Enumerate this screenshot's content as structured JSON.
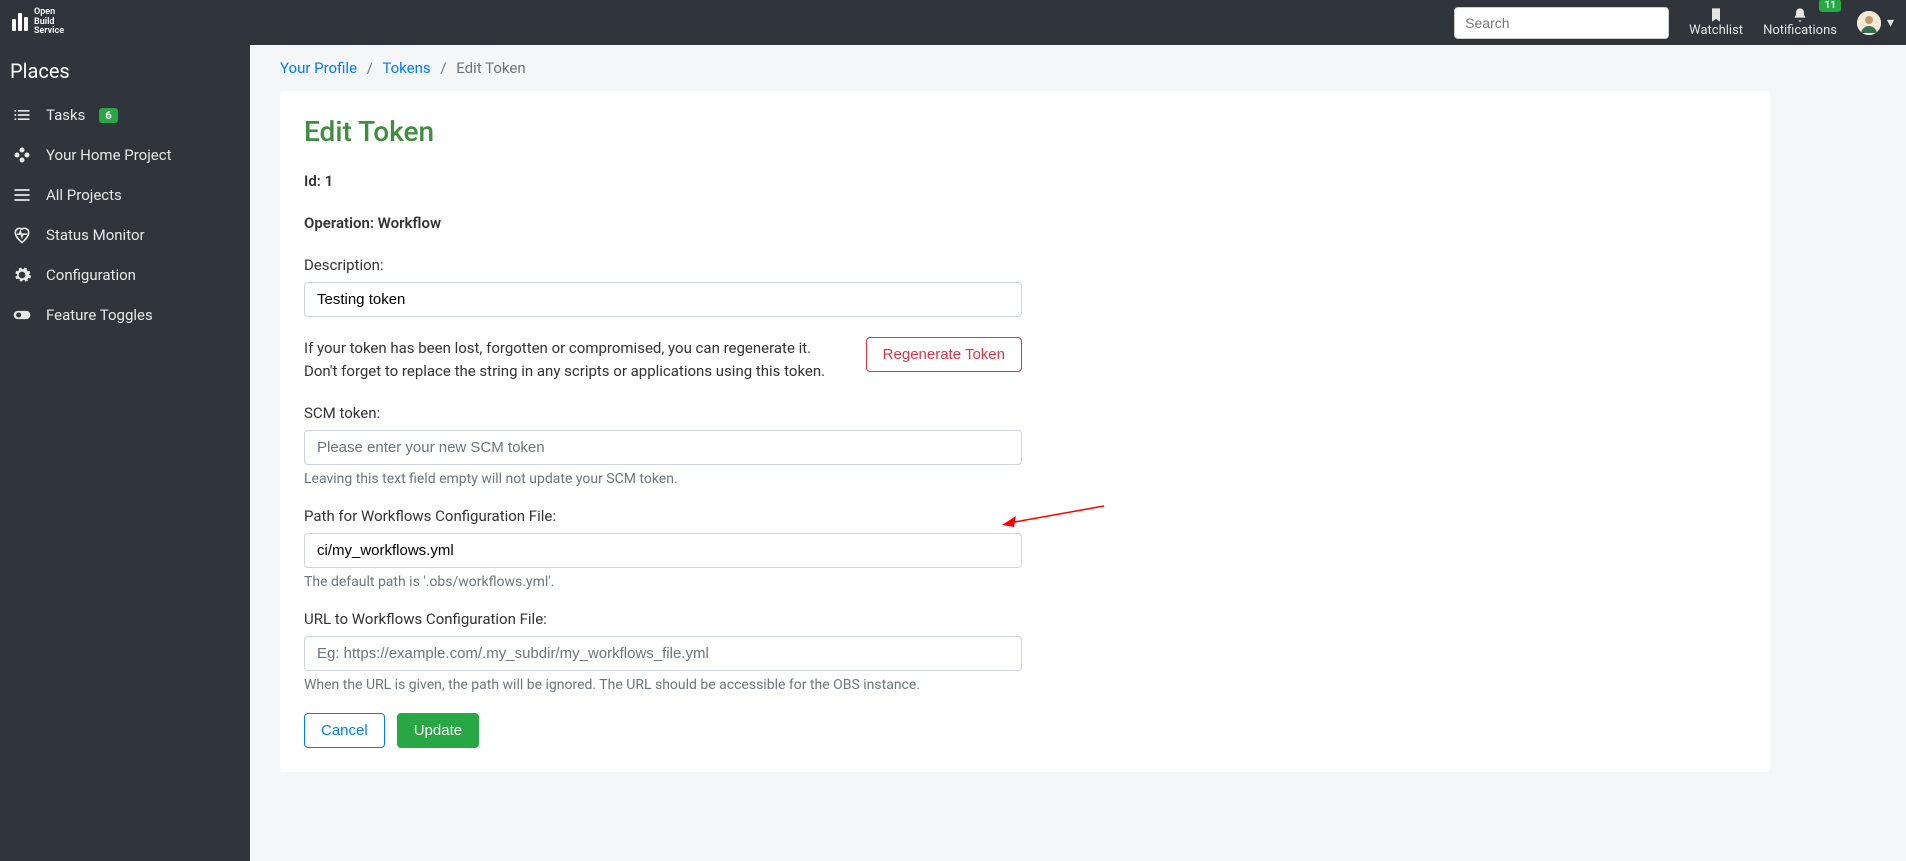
{
  "brand": "Open\nBuild\nService",
  "search": {
    "placeholder": "Search"
  },
  "topnav": {
    "watchlist": "Watchlist",
    "notifications": "Notifications",
    "notifications_count": "11"
  },
  "sidebar": {
    "header": "Places",
    "items": [
      {
        "label": "Tasks",
        "badge": "6"
      },
      {
        "label": "Your Home Project"
      },
      {
        "label": "All Projects"
      },
      {
        "label": "Status Monitor"
      },
      {
        "label": "Configuration"
      },
      {
        "label": "Feature Toggles"
      }
    ]
  },
  "breadcrumb": {
    "items": [
      "Your Profile",
      "Tokens",
      "Edit Token"
    ]
  },
  "page": {
    "title": "Edit Token",
    "id_line": "Id: 1",
    "operation_line": "Operation: Workflow"
  },
  "form": {
    "description_label": "Description:",
    "description_value": "Testing token",
    "regen_text": "If your token has been lost, forgotten or compromised, you can regenerate it. Don't forget to replace the string in any scripts or applications using this token.",
    "regen_button": "Regenerate Token",
    "scm_label": "SCM token:",
    "scm_placeholder": "Please enter your new SCM token",
    "scm_help": "Leaving this text field empty will not update your SCM token.",
    "path_label": "Path for Workflows Configuration File:",
    "path_value": "ci/my_workflows.yml",
    "path_help": "The default path is '.obs/workflows.yml'.",
    "url_label": "URL to Workflows Configuration File:",
    "url_placeholder": "Eg: https://example.com/.my_subdir/my_workflows_file.yml",
    "url_help": "When the URL is given, the path will be ignored. The URL should be accessible for the OBS instance.",
    "cancel": "Cancel",
    "update": "Update"
  }
}
